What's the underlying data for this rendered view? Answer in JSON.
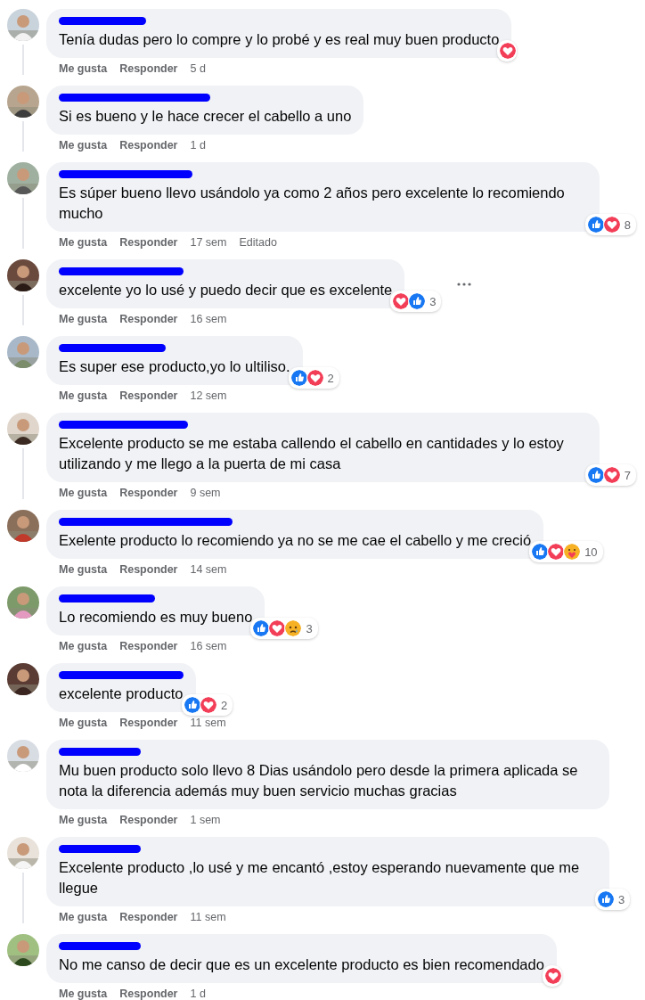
{
  "comments": [
    {
      "text": "Tenía dudas pero lo compre y lo probé y es real muy buen producto",
      "like_label": "Me gusta",
      "reply_label": "Responder",
      "time": "5 d",
      "reactions": [
        {
          "kind": "love"
        }
      ],
      "thread_line": true,
      "show_more": false
    },
    {
      "text": "Si es bueno y le hace crecer el cabello a uno",
      "like_label": "Me gusta",
      "reply_label": "Responder",
      "time": "1 d",
      "thread_line": true,
      "show_more": false
    },
    {
      "text": "Es súper bueno llevo usándolo ya como 2 años pero excelente lo recomiendo mucho",
      "like_label": "Me gusta",
      "reply_label": "Responder",
      "time": "17 sem",
      "edited": "Editado",
      "reactions": [
        {
          "kind": "like"
        },
        {
          "kind": "love"
        }
      ],
      "reaction_count": "8",
      "thread_line": true,
      "show_more": false
    },
    {
      "text": "excelente yo lo usé y puedo decir que es excelente",
      "like_label": "Me gusta",
      "reply_label": "Responder",
      "time": "16 sem",
      "reactions": [
        {
          "kind": "love"
        },
        {
          "kind": "like"
        }
      ],
      "reaction_count": "3",
      "thread_line": true,
      "show_more": true
    },
    {
      "text": "Es super ese producto,yo lo ultiliso.",
      "like_label": "Me gusta",
      "reply_label": "Responder",
      "time": "12 sem",
      "reactions": [
        {
          "kind": "like"
        },
        {
          "kind": "love"
        }
      ],
      "reaction_count": "2",
      "thread_line": false,
      "show_more": false
    },
    {
      "text": "Excelente producto se me estaba callendo el cabello en cantidades y lo estoy utilizando y me llego a la puerta de mi casa",
      "like_label": "Me gusta",
      "reply_label": "Responder",
      "time": "9 sem",
      "reactions": [
        {
          "kind": "like"
        },
        {
          "kind": "love"
        }
      ],
      "reaction_count": "7",
      "thread_line": true,
      "show_more": false
    },
    {
      "text": "Exelente producto lo recomiendo ya no se me cae el cabello y me creció",
      "like_label": "Me gusta",
      "reply_label": "Responder",
      "time": "14 sem",
      "reactions": [
        {
          "kind": "like"
        },
        {
          "kind": "love"
        },
        {
          "kind": "care"
        }
      ],
      "reaction_count": "10",
      "thread_line": false,
      "show_more": false
    },
    {
      "text": "Lo recomiendo es muy bueno",
      "like_label": "Me gusta",
      "reply_label": "Responder",
      "time": "16 sem",
      "reactions": [
        {
          "kind": "like"
        },
        {
          "kind": "love"
        },
        {
          "kind": "sad"
        }
      ],
      "reaction_count": "3",
      "thread_line": false,
      "show_more": false
    },
    {
      "text": "excelente producto",
      "like_label": "Me gusta",
      "reply_label": "Responder",
      "time": "11 sem",
      "reactions": [
        {
          "kind": "like"
        },
        {
          "kind": "love"
        }
      ],
      "reaction_count": "2",
      "thread_line": false,
      "show_more": false
    },
    {
      "text": "Mu buen producto solo llevo 8 Dias usándolo pero desde la primera aplicada se nota la diferencia además muy buen servicio muchas gracias",
      "like_label": "Me gusta",
      "reply_label": "Responder",
      "time": "1 sem",
      "thread_line": false,
      "show_more": false
    },
    {
      "text": "Excelente producto ,lo usé y me encantó ,estoy esperando nuevamente que me llegue",
      "like_label": "Me gusta",
      "reply_label": "Responder",
      "time": "11 sem",
      "reactions": [
        {
          "kind": "like"
        }
      ],
      "reaction_count": "3",
      "thread_line": true,
      "show_more": false
    },
    {
      "text": "No me canso de decir que es un excelente producto es bien recomendado",
      "like_label": "Me gusta",
      "reply_label": "Responder",
      "time": "1 d",
      "reactions": [
        {
          "kind": "love"
        }
      ],
      "thread_line": false,
      "show_more": false
    }
  ]
}
